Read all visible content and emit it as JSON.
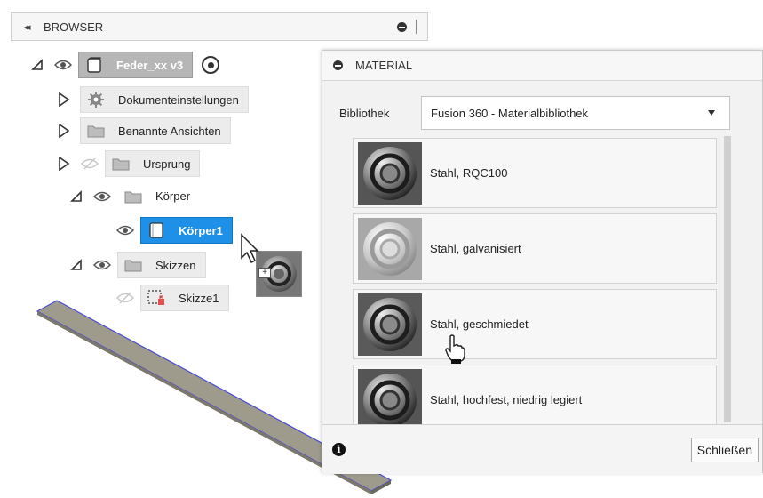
{
  "browser": {
    "title": "BROWSER",
    "collapse_glyph": "◂◂"
  },
  "tree": {
    "root": {
      "label": "Feder_xx v3",
      "icon": "component-icon"
    },
    "items": [
      {
        "label": "Dokumenteinstellungen",
        "icon": "gear-icon"
      },
      {
        "label": "Benannte Ansichten",
        "icon": "folder-icon"
      },
      {
        "label": "Ursprung",
        "icon": "folder-icon"
      },
      {
        "label": "Körper",
        "icon": "folder-icon"
      },
      {
        "label": "Körper1",
        "icon": "body-icon"
      },
      {
        "label": "Skizzen",
        "icon": "folder-icon"
      },
      {
        "label": "Skizze1",
        "icon": "sketch-icon"
      }
    ]
  },
  "material": {
    "title": "MATERIAL",
    "library_label": "Bibliothek",
    "library_value": "Fusion 360 - Materialbibliothek",
    "items": [
      {
        "name": "Stahl, RQC100"
      },
      {
        "name": "Stahl, galvanisiert"
      },
      {
        "name": "Stahl, geschmiedet"
      },
      {
        "name": "Stahl, hochfest, niedrig legiert"
      }
    ],
    "close_label": "Schließen",
    "info_glyph": "i"
  },
  "colors": {
    "selection": "#1e90e8",
    "plate_fill": "#9e9a8c",
    "plate_edge": "#4b4bd8"
  }
}
